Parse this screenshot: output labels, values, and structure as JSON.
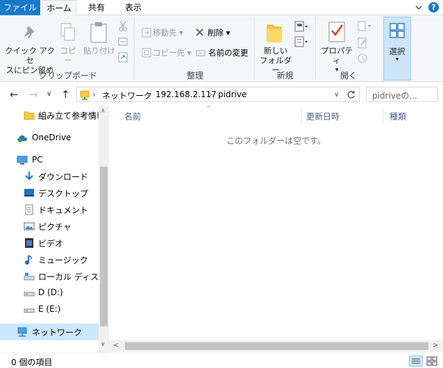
{
  "tabs": [
    "ファイル",
    "ホーム",
    "共有",
    "表示"
  ],
  "help_label": "?",
  "ribbon": {
    "clipboard": {
      "quick_access_label_1": "クイック アクセ",
      "quick_access_label_2": "スにピン留め",
      "copy_label": "コピー",
      "paste_label": "貼り付け",
      "group_label": "クリップボード"
    },
    "organize": {
      "move_to": "移動先",
      "copy_to": "コピー先",
      "delete": "削除",
      "rename": "名前の変更",
      "group_label": "整理"
    },
    "new": {
      "new_folder_1": "新しい",
      "new_folder_2": "フォルダー",
      "group_label": "新規"
    },
    "open": {
      "properties": "プロパティ",
      "group_label": "開く"
    },
    "select": {
      "label": "選択"
    }
  },
  "address": {
    "crumbs": [
      "ネットワーク",
      "192.168.2.117",
      "pidrive"
    ],
    "search_placeholder": "pidriveの..."
  },
  "nav": {
    "items": [
      {
        "label": "組み立て参考情報",
        "icon": "folder-icon"
      },
      {
        "label": "OneDrive",
        "icon": "onedrive-icon"
      },
      {
        "label": "PC",
        "icon": "pc-icon"
      },
      {
        "label": "ダウンロード",
        "icon": "download-icon"
      },
      {
        "label": "デスクトップ",
        "icon": "desktop-icon"
      },
      {
        "label": "ドキュメント",
        "icon": "document-icon"
      },
      {
        "label": "ピクチャ",
        "icon": "picture-icon"
      },
      {
        "label": "ビデオ",
        "icon": "video-icon"
      },
      {
        "label": "ミュージック",
        "icon": "music-icon"
      },
      {
        "label": "ローカル ディスク (C",
        "icon": "drive-icon"
      },
      {
        "label": "D (D:)",
        "icon": "drive-icon"
      },
      {
        "label": "E (E:)",
        "icon": "drive-icon"
      },
      {
        "label": "ネットワーク",
        "icon": "network-icon"
      }
    ]
  },
  "content": {
    "columns": [
      "名前",
      "更新日時",
      "種類"
    ],
    "empty_message": "このフォルダーは空です。"
  },
  "status": {
    "item_count": "0 個の項目"
  },
  "colors": {
    "file_tab": "#1979ca",
    "selection": "#cce8ff",
    "folder": "#f7c948"
  }
}
